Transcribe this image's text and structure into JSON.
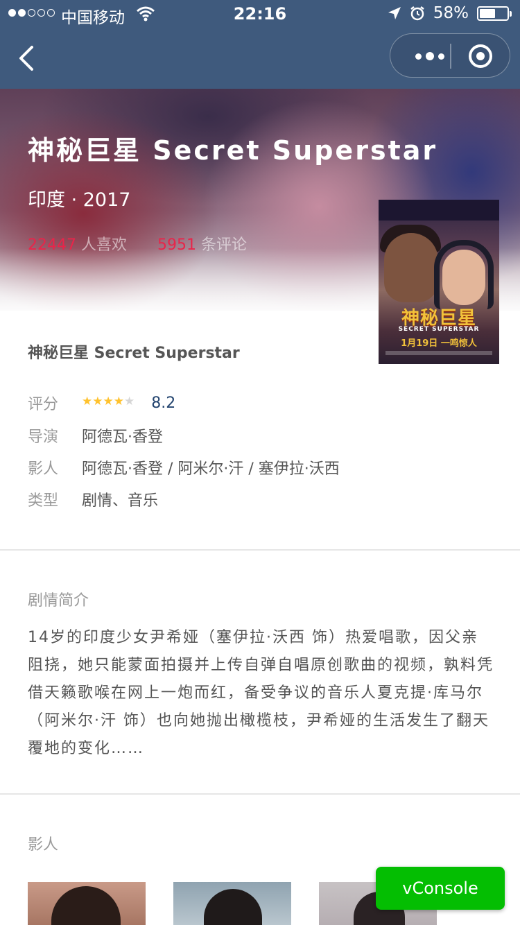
{
  "status_bar": {
    "carrier": "中国移动",
    "time": "22:16",
    "battery": "58%",
    "battery_level": 0.58
  },
  "hero": {
    "title": "神秘巨星 Secret Superstar",
    "meta": "印度 · 2017",
    "likes_count": "22447",
    "likes_label": "人喜欢",
    "comments_count": "5951",
    "comments_label": "条评论"
  },
  "poster": {
    "title_art": "神秘巨星",
    "subtitle_art": "SECRET SUPERSTAR",
    "date_art": "1月19日 一鸣惊人"
  },
  "info": {
    "title": "神秘巨星 Secret Superstar",
    "rating_label": "评分",
    "rating": "8.2",
    "stars": 4,
    "director_label": "导演",
    "director": "阿德瓦·香登",
    "cast_label": "影人",
    "cast": "阿德瓦·香登 / 阿米尔·汗 / 塞伊拉·沃西",
    "genre_label": "类型",
    "genre": "剧情、音乐"
  },
  "synopsis": {
    "heading": "剧情简介",
    "text": "14岁的印度少女尹希娅（塞伊拉·沃西 饰）热爱唱歌，因父亲阻挠，她只能蒙面拍摄并上传自弹自唱原创歌曲的视频，孰料凭借天籁歌喉在网上一炮而红，备受争议的音乐人夏克提·库马尔（阿米尔·汗 饰）也向她抛出橄榄枝，尹希娅的生活发生了翻天覆地的变化……"
  },
  "cast_section": {
    "heading": "影人"
  },
  "vconsole": {
    "label": "vConsole"
  },
  "colors": {
    "nav_bg": "#3f5a7d",
    "accent_red": "#e8254a",
    "rating_blue": "#23446f",
    "star_yellow": "#ffc22e",
    "vconsole_green": "#04be02"
  }
}
